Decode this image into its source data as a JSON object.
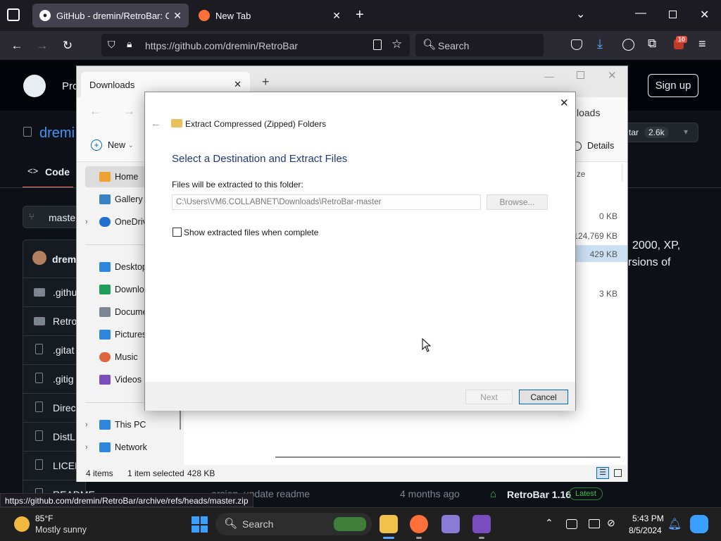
{
  "browser": {
    "tabs": [
      {
        "label": "GitHub - dremin/RetroBar: Cla",
        "active": true
      },
      {
        "label": "New Tab",
        "active": false
      }
    ],
    "new_tab_glyph": "+",
    "url": "https://github.com/dremin/RetroBar",
    "search_placeholder": "Search",
    "extensions_badge": "10",
    "status_url": "https://github.com/dremin/RetroBar/archive/refs/heads/master.zip"
  },
  "github": {
    "header_prod": "Pro",
    "signup": "Sign up",
    "repo_owner": "dremi",
    "tab_code": "Code",
    "branch": "maste",
    "commit_author": "dremi",
    "star_label": "tar",
    "star_count": "2.6k",
    "files": [
      ".githu",
      "Retro",
      ".gitat",
      ".gitig",
      "Direc",
      "DistL",
      "LICEN",
      "README"
    ],
    "readme_text": [
      "2000, XP,",
      "rsions of"
    ],
    "last_commit_msg": "ersion, update readme",
    "last_commit_time": "4 months ago",
    "release_name": "RetroBar 1.16",
    "release_badge": "Latest"
  },
  "explorer": {
    "tab_title": "Downloads",
    "breadcrumb_tail": "loads",
    "new_label": "New",
    "details_label": "Details",
    "col_size": "ze",
    "sizes": [
      "0 KB",
      "124,769 KB",
      "429 KB",
      "3 KB"
    ],
    "sidebar": [
      {
        "label": "Home",
        "color": "#f0a030"
      },
      {
        "label": "Gallery",
        "color": "#3b82c4"
      },
      {
        "label": "OneDriv",
        "color": "#1e6fd0"
      },
      {
        "label": "Desktop",
        "color": "#2e86de"
      },
      {
        "label": "Downlo",
        "color": "#1e9e5a"
      },
      {
        "label": "Docume",
        "color": "#7b8794"
      },
      {
        "label": "Pictures",
        "color": "#2e86de"
      },
      {
        "label": "Music",
        "color": "#e0643c"
      },
      {
        "label": "Videos",
        "color": "#7c4dbe"
      },
      {
        "label": "This PC",
        "color": "#2e86de"
      },
      {
        "label": "Network",
        "color": "#2e86de"
      }
    ],
    "status_items": "4 items",
    "status_selected": "1 item selected",
    "status_size": "428 KB"
  },
  "dialog": {
    "window_title": "Extract Compressed (Zipped) Folders",
    "heading": "Select a Destination and Extract Files",
    "folder_label": "Files will be extracted to this folder:",
    "folder_path": "C:\\Users\\VM6.COLLABNET\\Downloads\\RetroBar-master",
    "browse": "Browse...",
    "show_files_label": "Show extracted files when complete",
    "show_files_checked": false,
    "next": "Next",
    "cancel": "Cancel"
  },
  "taskbar": {
    "weather_temp": "85°F",
    "weather_desc": "Mostly sunny",
    "search_label": "Search",
    "time": "5:43 PM",
    "date": "8/5/2024"
  },
  "colors": {
    "accent_blue": "#0067c0",
    "dialog_heading": "#1e3a78",
    "firefox_orange": "#ff7139"
  }
}
